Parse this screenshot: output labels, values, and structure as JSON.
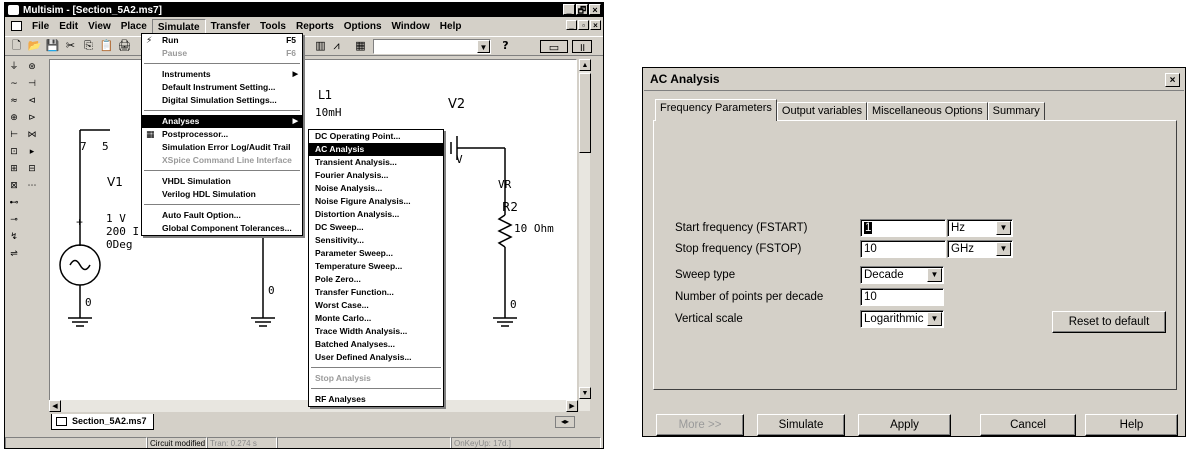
{
  "multisim": {
    "title": "Multisim - [Section_5A2.ms7]",
    "window_buttons": [
      "_",
      "🗗",
      "×"
    ],
    "menubar": [
      "File",
      "Edit",
      "View",
      "Place",
      "Simulate",
      "Transfer",
      "Tools",
      "Reports",
      "Options",
      "Window",
      "Help"
    ],
    "toolbar_glyphs": [
      "🗋",
      "📂",
      "💾",
      "✂",
      "⎘",
      "📋",
      "🖨"
    ],
    "toolbar_combo_value": "",
    "toolbar_help": "?",
    "left_tools": [
      "⏚",
      "⊛",
      "~",
      "⊣",
      "≈",
      "⊲",
      "⊕",
      "⊳",
      "⊢",
      "⋈",
      "⊡",
      "▸",
      "⊞",
      "⊟",
      "⊠",
      "⋯"
    ],
    "simulate_menu": [
      {
        "label": "Run",
        "shortcut": "F5",
        "icon": "⚡",
        "disabled": false
      },
      {
        "label": "Pause",
        "shortcut": "F6",
        "disabled": true
      },
      {
        "sep": true
      },
      {
        "label": "Instruments",
        "submenu": true
      },
      {
        "label": "Default Instrument Setting..."
      },
      {
        "label": "Digital Simulation Settings..."
      },
      {
        "sep": true
      },
      {
        "label": "Analyses",
        "submenu": true,
        "highlight": true
      },
      {
        "label": "Postprocessor...",
        "icon": "▦"
      },
      {
        "label": "Simulation Error Log/Audit Trail"
      },
      {
        "label": "XSpice Command Line Interface",
        "disabled": true
      },
      {
        "sep": true
      },
      {
        "label": "VHDL Simulation"
      },
      {
        "label": "Verilog HDL Simulation"
      },
      {
        "sep": true
      },
      {
        "label": "Auto Fault Option..."
      },
      {
        "label": "Global Component Tolerances..."
      }
    ],
    "analyses_menu": [
      "DC Operating Point...",
      "AC Analysis",
      "Transient Analysis...",
      "Fourier Analysis...",
      "Noise Analysis...",
      "Noise Figure Analysis...",
      "Distortion Analysis...",
      "DC Sweep...",
      "Sensitivity...",
      "Parameter Sweep...",
      "Temperature Sweep...",
      "Pole Zero...",
      "Transfer Function...",
      "Worst Case...",
      "Monte Carlo...",
      "Trace Width Analysis...",
      "Batched Analyses...",
      "User Defined Analysis...",
      "Stop Analysis",
      "RF Analyses"
    ],
    "schematic": {
      "L1_name": "L1",
      "L1_value": "10mH",
      "V2_name": "V2",
      "V2_value": "V",
      "V1_name": "V1",
      "V1_value": "1 V",
      "V1_freq": "200 I",
      "V1_phase": "0Deg",
      "R2_name": "R2",
      "R2_value": "10 Ohm",
      "VR_label": "VR",
      "node_7": "7",
      "node_5": "5",
      "node_0a": "0",
      "node_0b": "0",
      "node_0c": "0",
      "plus": "+",
      "minus": "−"
    },
    "doc_tab": "Section_5A2.ms7",
    "status": [
      "Circuit modified",
      "Tran: 0.274 s",
      "OnKeyUp: 17d.]"
    ]
  },
  "ac": {
    "title": "AC Analysis",
    "close": "×",
    "tabs": [
      "Frequency Parameters",
      "Output variables",
      "Miscellaneous Options",
      "Summary"
    ],
    "fields": [
      {
        "label": "Start frequency (FSTART)",
        "value": "1",
        "unit": "Hz"
      },
      {
        "label": "Stop frequency (FSTOP)",
        "value": "10",
        "unit": "GHz"
      },
      {
        "label": "Sweep type",
        "select": "Decade"
      },
      {
        "label": "Number of points per decade",
        "value": "10"
      },
      {
        "label": "Vertical scale",
        "select": "Logarithmic"
      }
    ],
    "reset_button": "Reset to default",
    "buttons": [
      "More >>",
      "Simulate",
      "Apply",
      "Cancel",
      "Help"
    ]
  }
}
